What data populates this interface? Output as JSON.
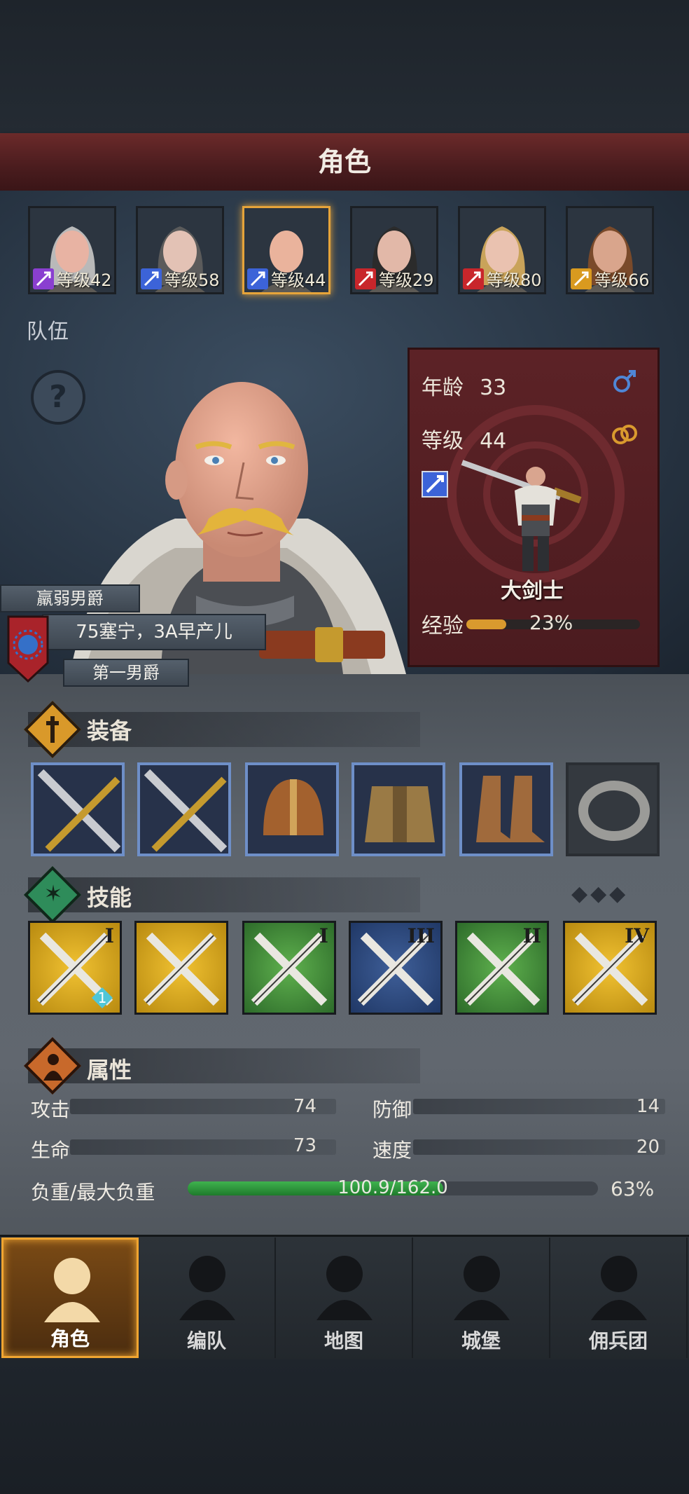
{
  "header": {
    "title": "角色"
  },
  "roster": [
    {
      "level": "等级42",
      "class_icon": "staff-icon",
      "class_color": "#8a3fd0",
      "selected": false
    },
    {
      "level": "等级58",
      "class_icon": "sword-icon",
      "class_color": "#3c63d8",
      "selected": false
    },
    {
      "level": "等级44",
      "class_icon": "sword-icon",
      "class_color": "#3c63d8",
      "selected": true
    },
    {
      "level": "等级29",
      "class_icon": "wolf-icon",
      "class_color": "#c8262b",
      "selected": false
    },
    {
      "level": "等级80",
      "class_icon": "wolf-icon",
      "class_color": "#c8262b",
      "selected": false
    },
    {
      "level": "等级66",
      "class_icon": "shield-icon",
      "class_color": "#d99a1f",
      "selected": false
    }
  ],
  "team_label": "队伍",
  "hero": {
    "title_top": "羸弱男爵",
    "trait": "75塞宁，3A早产儿",
    "title_bottom": "第一男爵"
  },
  "info": {
    "age_label": "年龄",
    "age": "33",
    "level_label": "等级",
    "level": "44",
    "class_name": "大剑士",
    "exp_label": "经验",
    "exp_percent": "23%",
    "exp_fraction": 0.23
  },
  "equipment": {
    "title": "装备",
    "items": [
      "greatsword-icon",
      "greatsword-icon",
      "helmet-icon",
      "armor-icon",
      "boots-icon",
      "ring-icon"
    ]
  },
  "skills": {
    "title": "技能",
    "items": [
      {
        "icon": "multi-sword-icon",
        "rank": "I",
        "color": "gold",
        "badge": "1"
      },
      {
        "icon": "sword-aura-icon",
        "rank": "",
        "color": "gold"
      },
      {
        "icon": "crystal-burst-icon",
        "rank": "I",
        "color": "green"
      },
      {
        "icon": "cross-swords-icon",
        "rank": "III",
        "color": "blue"
      },
      {
        "icon": "burst-icon",
        "rank": "II",
        "color": "green"
      },
      {
        "icon": "cross-swords-icon",
        "rank": "IV",
        "color": "gold"
      }
    ]
  },
  "attributes": {
    "title": "属性",
    "attack_label": "攻击",
    "attack": "74",
    "defense_label": "防御",
    "defense": "14",
    "hp_label": "生命",
    "hp": "73",
    "speed_label": "速度",
    "speed": "20",
    "weight_label": "负重/最大负重",
    "weight": "100.9/162.0",
    "weight_percent": "63%",
    "weight_fraction": 0.623
  },
  "nav": [
    {
      "label": "角色",
      "icon": "knight-icon",
      "active": true
    },
    {
      "label": "编队",
      "icon": "helmet-squad-icon",
      "active": false
    },
    {
      "label": "地图",
      "icon": "compass-icon",
      "active": false
    },
    {
      "label": "城堡",
      "icon": "castle-icon",
      "active": false
    },
    {
      "label": "佣兵团",
      "icon": "banner-fist-icon",
      "active": false
    }
  ]
}
